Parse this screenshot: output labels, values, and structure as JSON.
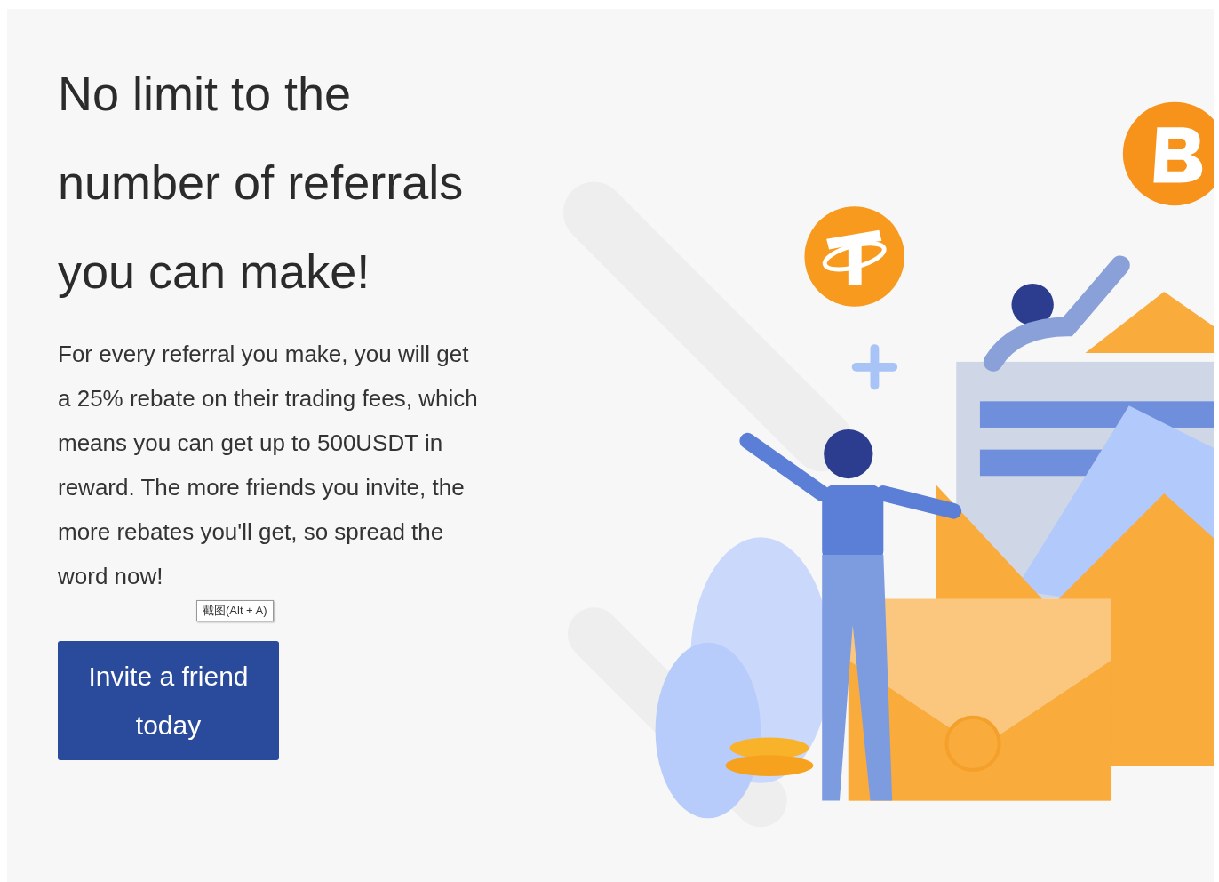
{
  "headline": "No limit to the number of referrals you can make!",
  "description": "For every referral you make, you will get a 25% rebate on their trading fees, which means you can get up to 500USDT in reward. The more friends you invite, the more rebates you'll get, so spread the word now!",
  "tooltip": "截图(Alt + A)",
  "button": "Invite a friend today"
}
